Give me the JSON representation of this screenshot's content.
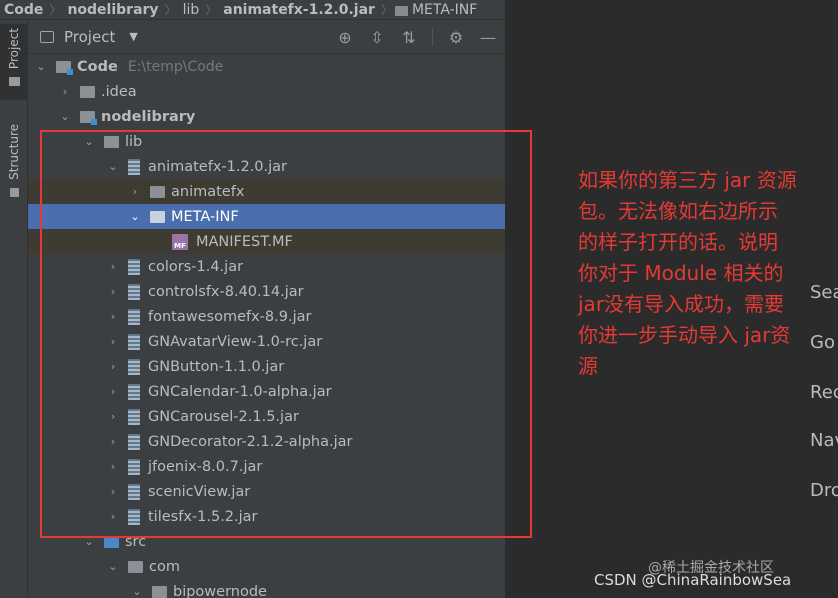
{
  "breadcrumb": [
    "Code",
    "nodelibrary",
    "lib",
    "animatefx-1.2.0.jar",
    "META-INF"
  ],
  "toolstrip": {
    "project_label": "Project",
    "structure_label": "Structure"
  },
  "panel": {
    "title": "Project",
    "icons": [
      "target-icon",
      "expand-all-icon",
      "collapse-all-icon",
      "gear-icon",
      "minimize-icon"
    ]
  },
  "tree": {
    "root": {
      "name": "Code",
      "path": "E:\\temp\\Code"
    },
    "idea": ".idea",
    "nodelibrary": "nodelibrary",
    "lib": "lib",
    "animatefx_jar": "animatefx-1.2.0.jar",
    "animatefx_pkg": "animatefx",
    "meta_inf": "META-INF",
    "manifest": "MANIFEST.MF",
    "manifest_badge": "MF",
    "jars": [
      "colors-1.4.jar",
      "controlsfx-8.40.14.jar",
      "fontawesomefx-8.9.jar",
      "GNAvatarView-1.0-rc.jar",
      "GNButton-1.1.0.jar",
      "GNCalendar-1.0-alpha.jar",
      "GNCarousel-2.1.5.jar",
      "GNDecorator-2.1.2-alpha.jar",
      "jfoenix-8.0.7.jar",
      "scenicView.jar",
      "tilesfx-1.5.2.jar"
    ],
    "src": "src",
    "com": "com",
    "bipowernode": "bipowernode"
  },
  "annotation": {
    "lines": [
      "如果你的第三方 jar 资源",
      "包。无法像如右边所示",
      "的样子打开的话。说明",
      "你对于 Module 相关的",
      "jar没有导入成功，需要",
      "你进一步手动导入 jar资",
      "源"
    ],
    "color": "#e53935"
  },
  "editor": {
    "partial_texts": [
      "Sea",
      "Go",
      "Rec",
      "Nav",
      "Dro"
    ]
  },
  "watermarks": {
    "juejin": "@稀土掘金技术社区",
    "csdn": "CSDN @ChinaRainbowSea"
  }
}
